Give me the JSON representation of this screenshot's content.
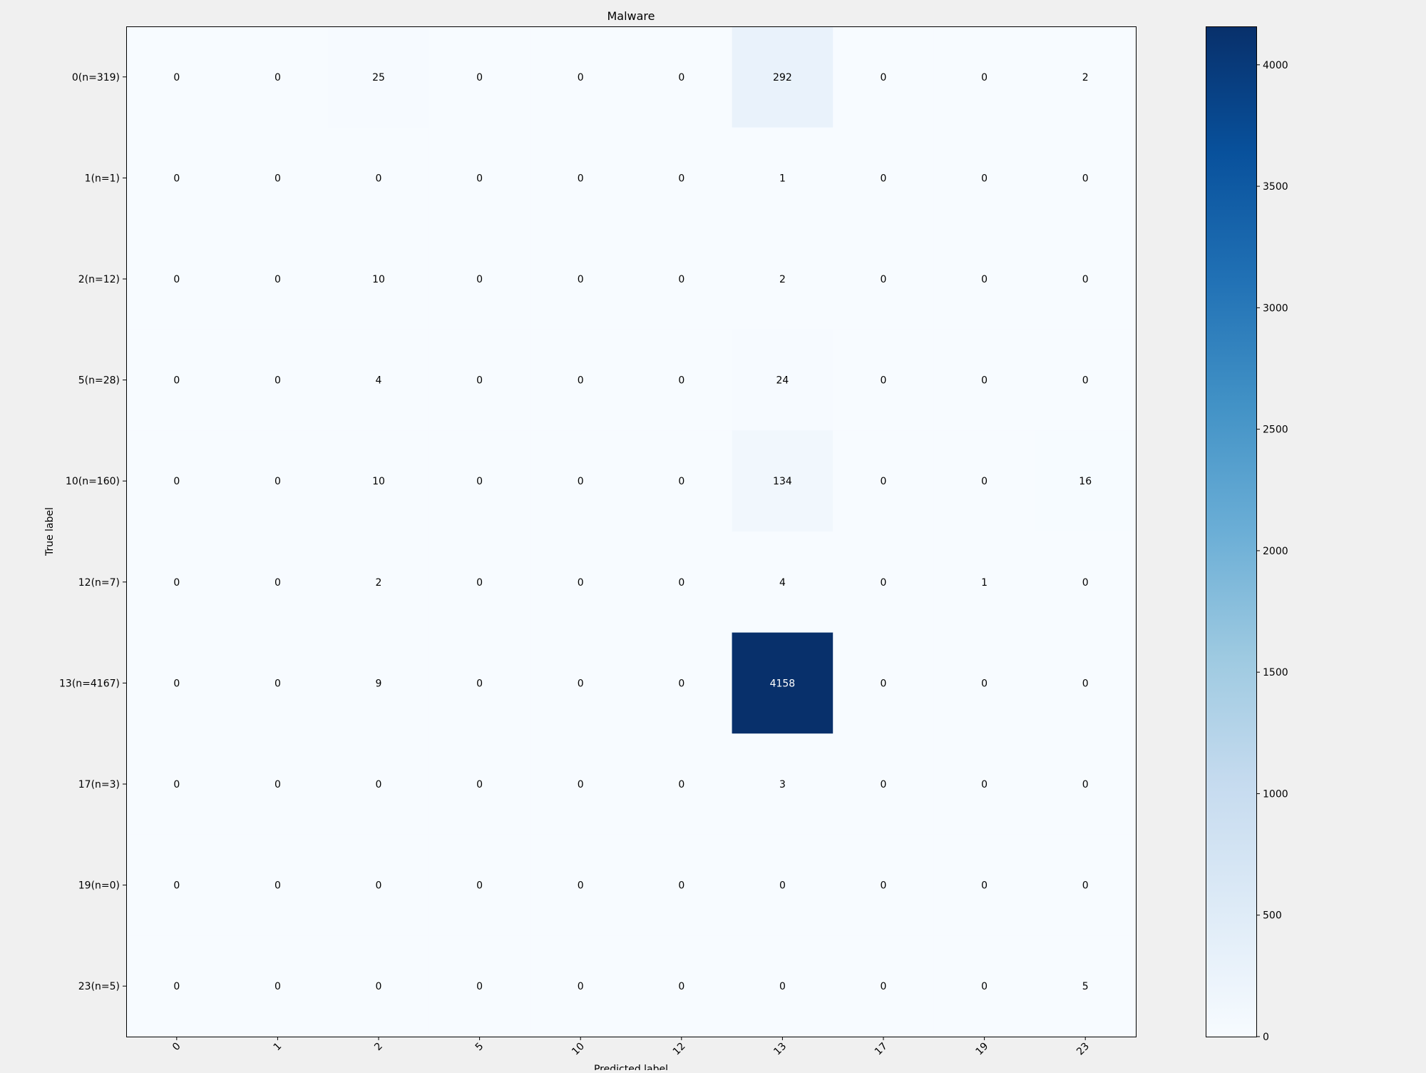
{
  "chart_data": {
    "type": "heatmap",
    "title": "Malware",
    "xlabel": "Predicted label",
    "ylabel": "True label",
    "x_categories": [
      "0",
      "1",
      "2",
      "5",
      "10",
      "12",
      "13",
      "17",
      "19",
      "23"
    ],
    "y_categories": [
      "0(n=319)",
      "1(n=1)",
      "2(n=12)",
      "5(n=28)",
      "10(n=160)",
      "12(n=7)",
      "13(n=4167)",
      "17(n=3)",
      "19(n=0)",
      "23(n=5)"
    ],
    "values": [
      [
        0,
        0,
        25,
        0,
        0,
        0,
        292,
        0,
        0,
        2
      ],
      [
        0,
        0,
        0,
        0,
        0,
        0,
        1,
        0,
        0,
        0
      ],
      [
        0,
        0,
        10,
        0,
        0,
        0,
        2,
        0,
        0,
        0
      ],
      [
        0,
        0,
        4,
        0,
        0,
        0,
        24,
        0,
        0,
        0
      ],
      [
        0,
        0,
        10,
        0,
        0,
        0,
        134,
        0,
        0,
        16
      ],
      [
        0,
        0,
        2,
        0,
        0,
        0,
        4,
        0,
        1,
        0
      ],
      [
        0,
        0,
        9,
        0,
        0,
        0,
        4158,
        0,
        0,
        0
      ],
      [
        0,
        0,
        0,
        0,
        0,
        0,
        3,
        0,
        0,
        0
      ],
      [
        0,
        0,
        0,
        0,
        0,
        0,
        0,
        0,
        0,
        0
      ],
      [
        0,
        0,
        0,
        0,
        0,
        0,
        0,
        0,
        0,
        5
      ]
    ],
    "colormap": "Blues",
    "color_range": [
      0,
      4158
    ],
    "colorbar_ticks": [
      0,
      500,
      1000,
      1500,
      2000,
      2500,
      3000,
      3500,
      4000
    ],
    "xtick_rotation_deg": 45,
    "grid": false
  }
}
